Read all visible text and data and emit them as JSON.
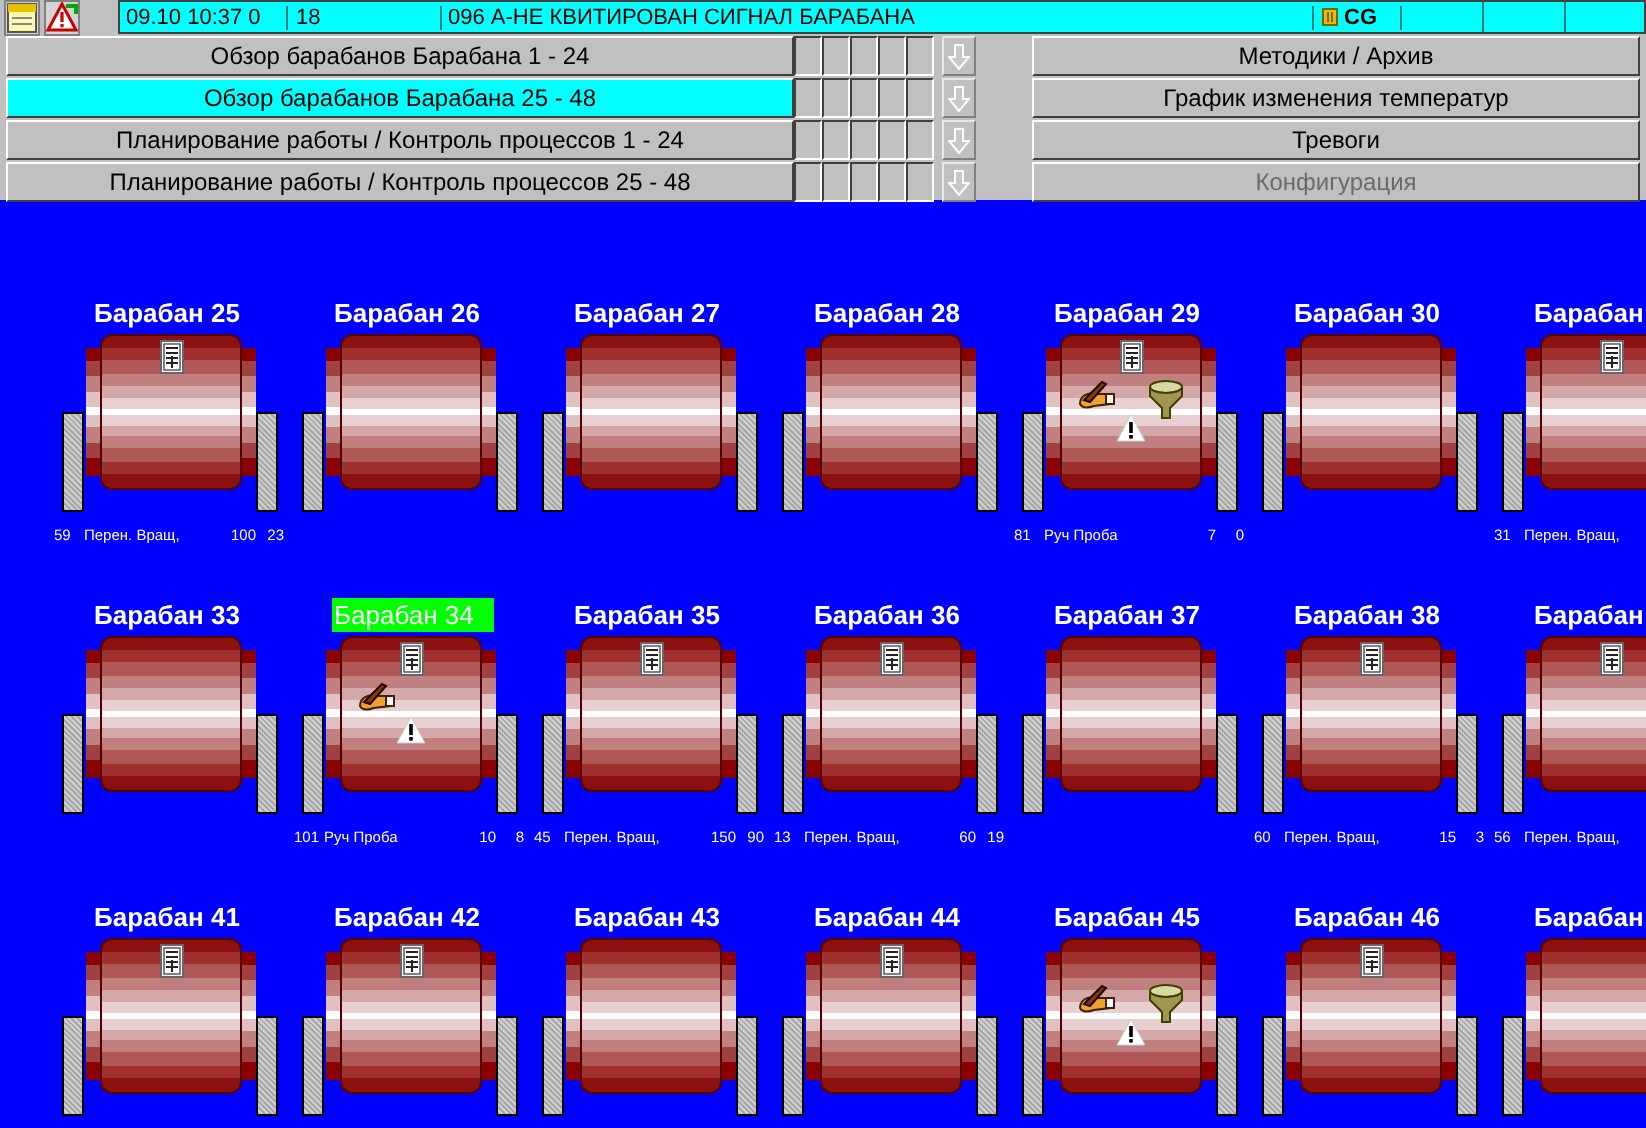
{
  "status_bar": {
    "date_time": "09.10 10:37 0",
    "count": "18",
    "message": "096 А-НЕ КВИТИРОВАН СИГНАЛ БАРАБАНА",
    "code": "CG"
  },
  "nav": {
    "left": [
      {
        "label": "Обзор барабанов Барабана 1 - 24",
        "selected": false
      },
      {
        "label": "Обзор барабанов Барабана 25 - 48",
        "selected": true
      },
      {
        "label": "Планирование работы / Контроль процессов  1 - 24",
        "selected": false
      },
      {
        "label": "Планирование работы / Контроль процессов 25 - 48",
        "selected": false
      }
    ],
    "right": [
      {
        "label": "Методики / Архив",
        "disabled": false
      },
      {
        "label": "График изменения температур",
        "disabled": false
      },
      {
        "label": "Тревоги",
        "disabled": false
      },
      {
        "label": "Конфигурация",
        "disabled": true
      }
    ]
  },
  "drum_rows": [
    {
      "drums": [
        {
          "label": "Барабан 25",
          "selected": false,
          "document": true,
          "manual": false,
          "funnel": false,
          "warning": false,
          "readings": {
            "cycle": "59",
            "mode": "Перен. Вращ,",
            "value_1": "100",
            "value_2": "23"
          }
        },
        {
          "label": "Барабан 26",
          "selected": false,
          "document": false,
          "manual": false,
          "funnel": false,
          "warning": false
        },
        {
          "label": "Барабан 27",
          "selected": false,
          "document": false,
          "manual": false,
          "funnel": false,
          "warning": false
        },
        {
          "label": "Барабан 28",
          "selected": false,
          "document": false,
          "manual": false,
          "funnel": false,
          "warning": false
        },
        {
          "label": "Барабан 29",
          "selected": false,
          "document": true,
          "manual": true,
          "funnel": true,
          "warning": true,
          "readings": {
            "cycle": "81",
            "mode": "Руч Проба",
            "value_1": "7",
            "value_2": "0"
          }
        },
        {
          "label": "Барабан 30",
          "selected": false,
          "document": false,
          "manual": false,
          "funnel": false,
          "warning": false
        },
        {
          "label": "Барабан",
          "selected": false,
          "document": true,
          "manual": false,
          "funnel": false,
          "warning": false,
          "readings": {
            "cycle": "31",
            "mode": "Перен. Вращ,"
          }
        }
      ]
    },
    {
      "drums": [
        {
          "label": "Барабан 33",
          "selected": false,
          "document": false,
          "manual": false,
          "funnel": false,
          "warning": false
        },
        {
          "label": "Барабан 34",
          "selected": true,
          "document": true,
          "manual": true,
          "funnel": false,
          "warning": true,
          "readings": {
            "cycle": "101",
            "mode": "Руч Проба",
            "value_1": "10",
            "value_2": "8"
          }
        },
        {
          "label": "Барабан 35",
          "selected": false,
          "document": true,
          "manual": false,
          "funnel": false,
          "warning": false,
          "readings": {
            "cycle": "45",
            "mode": "Перен. Вращ,",
            "value_1": "150",
            "value_2": "90"
          }
        },
        {
          "label": "Барабан 36",
          "selected": false,
          "document": true,
          "manual": false,
          "funnel": false,
          "warning": false,
          "readings": {
            "cycle": "13",
            "mode": "Перен. Вращ,",
            "value_1": "60",
            "value_2": "19"
          }
        },
        {
          "label": "Барабан 37",
          "selected": false,
          "document": false,
          "manual": false,
          "funnel": false,
          "warning": false
        },
        {
          "label": "Барабан 38",
          "selected": false,
          "document": true,
          "manual": false,
          "funnel": false,
          "warning": false,
          "readings": {
            "cycle": "60",
            "mode": "Перен. Вращ,",
            "value_1": "15",
            "value_2": "3"
          }
        },
        {
          "label": "Барабан",
          "selected": false,
          "document": true,
          "manual": false,
          "funnel": false,
          "warning": false,
          "readings": {
            "cycle": "56",
            "mode": "Перен. Вращ,"
          }
        }
      ]
    },
    {
      "drums": [
        {
          "label": "Барабан 41",
          "selected": false,
          "document": true,
          "manual": false,
          "funnel": false,
          "warning": false
        },
        {
          "label": "Барабан 42",
          "selected": false,
          "document": true,
          "manual": false,
          "funnel": false,
          "warning": false
        },
        {
          "label": "Барабан 43",
          "selected": false,
          "document": false,
          "manual": false,
          "funnel": false,
          "warning": false
        },
        {
          "label": "Барабан 44",
          "selected": false,
          "document": true,
          "manual": false,
          "funnel": false,
          "warning": false
        },
        {
          "label": "Барабан 45",
          "selected": false,
          "document": false,
          "manual": true,
          "funnel": true,
          "warning": true
        },
        {
          "label": "Барабан 46",
          "selected": false,
          "document": true,
          "manual": false,
          "funnel": false,
          "warning": false
        },
        {
          "label": "Барабан",
          "selected": false,
          "document": false,
          "manual": false,
          "funnel": false,
          "warning": false
        }
      ]
    }
  ]
}
